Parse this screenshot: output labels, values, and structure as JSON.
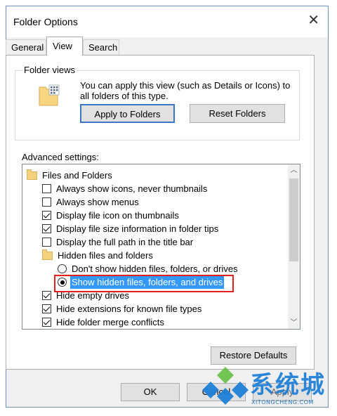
{
  "window": {
    "title": "Folder Options",
    "close_icon": "close-icon"
  },
  "tabs": [
    {
      "label": "General",
      "active": false
    },
    {
      "label": "View",
      "active": true
    },
    {
      "label": "Search",
      "active": false
    }
  ],
  "folder_views": {
    "legend": "Folder views",
    "description": "You can apply this view (such as Details or Icons) to all folders of this type.",
    "apply_button": "Apply to Folders",
    "reset_button": "Reset Folders"
  },
  "advanced": {
    "label": "Advanced settings:",
    "items": [
      {
        "type": "folder",
        "label": "Files and Folders"
      },
      {
        "type": "checkbox",
        "label": "Always show icons, never thumbnails",
        "checked": false
      },
      {
        "type": "checkbox",
        "label": "Always show menus",
        "checked": false
      },
      {
        "type": "checkbox",
        "label": "Display file icon on thumbnails",
        "checked": true
      },
      {
        "type": "checkbox",
        "label": "Display file size information in folder tips",
        "checked": true
      },
      {
        "type": "checkbox",
        "label": "Display the full path in the title bar",
        "checked": false
      },
      {
        "type": "folder",
        "label": "Hidden files and folders"
      },
      {
        "type": "radio",
        "label": "Don't show hidden files, folders, or drives",
        "checked": false
      },
      {
        "type": "radio",
        "label": "Show hidden files, folders, and drives",
        "checked": true,
        "highlighted": true
      },
      {
        "type": "checkbox",
        "label": "Hide empty drives",
        "checked": true
      },
      {
        "type": "checkbox",
        "label": "Hide extensions for known file types",
        "checked": true
      },
      {
        "type": "checkbox",
        "label": "Hide folder merge conflicts",
        "checked": true
      }
    ]
  },
  "buttons": {
    "restore_defaults": "Restore Defaults",
    "ok": "OK",
    "cancel": "Cancel",
    "apply": "Apply"
  },
  "watermark": {
    "text": "系统城",
    "subtext": "XITONGCHENG.COM"
  },
  "colors": {
    "highlight": "#3399ff",
    "annotation_box": "#e02020",
    "watermark": "#1e7fd6"
  }
}
